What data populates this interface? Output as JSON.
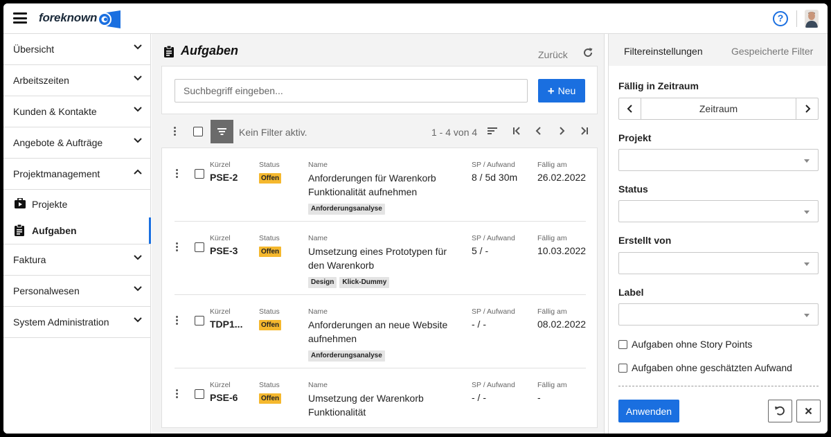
{
  "app": {
    "brand": "foreknown",
    "help_label": "?"
  },
  "sidebar": {
    "items": [
      {
        "label": "Übersicht"
      },
      {
        "label": "Arbeitszeiten"
      },
      {
        "label": "Kunden & Kontakte"
      },
      {
        "label": "Angebote & Aufträge"
      },
      {
        "label": "Projektmanagement"
      },
      {
        "label": "Faktura"
      },
      {
        "label": "Personalwesen"
      },
      {
        "label": "System Administration"
      }
    ],
    "sub_items": [
      {
        "label": "Projekte"
      },
      {
        "label": "Aufgaben"
      }
    ]
  },
  "main": {
    "title": "Aufgaben",
    "back_label": "Zurück",
    "search_placeholder": "Suchbegriff eingeben...",
    "new_label": "Neu",
    "no_filter": "Kein Filter aktiv.",
    "pager_info": "1 - 4 von 4",
    "columns": {
      "kuerzel": "Kürzel",
      "status": "Status",
      "name": "Name",
      "sp": "SP / Aufwand",
      "due": "Fällig am"
    },
    "rows": [
      {
        "kuerzel": "PSE-2",
        "status": "Offen",
        "name": "Anforderungen für Warenkorb Funktionalität aufnehmen",
        "tags": [
          "Anforderungsanalyse"
        ],
        "sp": "8 / 5d 30m",
        "due": "26.02.2022"
      },
      {
        "kuerzel": "PSE-3",
        "status": "Offen",
        "name": "Umsetzung eines Prototypen für den Warenkorb",
        "tags": [
          "Design",
          "Klick-Dummy"
        ],
        "sp": "5 / -",
        "due": "10.03.2022"
      },
      {
        "kuerzel": "TDP1...",
        "status": "Offen",
        "name": "Anforderungen an neue Website aufnehmen",
        "tags": [
          "Anforderungsanalyse"
        ],
        "sp": "- / -",
        "due": "08.02.2022"
      },
      {
        "kuerzel": "PSE-6",
        "status": "Offen",
        "name": "Umsetzung der Warenkorb Funktionalität",
        "tags": [],
        "sp": "- / -",
        "due": "-"
      }
    ]
  },
  "filter": {
    "tab_settings": "Filtereinstellungen",
    "tab_saved": "Gespeicherte Filter",
    "due_label": "Fällig in Zeitraum",
    "range_label": "Zeitraum",
    "project_label": "Projekt",
    "status_label": "Status",
    "created_by_label": "Erstellt von",
    "label_label": "Label",
    "check_no_sp": "Aufgaben ohne Story Points",
    "check_no_estimate": "Aufgaben ohne geschätzten Aufwand",
    "apply_label": "Anwenden"
  },
  "colors": {
    "accent": "#1a6fe0",
    "status_open": "#f5b82e"
  }
}
